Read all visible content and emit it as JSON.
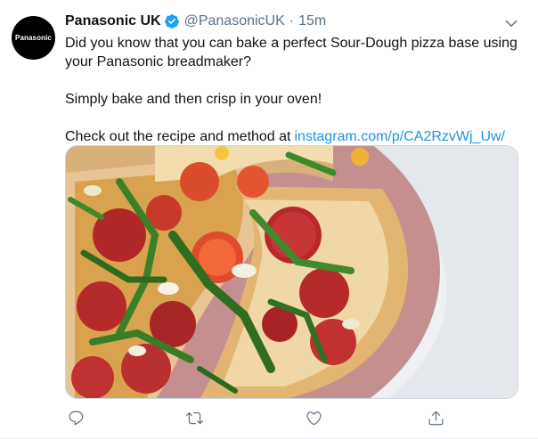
{
  "tweet": {
    "avatar_text": "Panasonic",
    "author_name": "Panasonic UK",
    "handle": "@PanasonicUK",
    "separator": "·",
    "time": "15m",
    "lines": [
      "Did you know that you can bake a perfect Sour-Dough pizza base using your Panasonic breadmaker?",
      "Simply bake and then crisp in your oven!",
      "Check out the recipe and method at"
    ],
    "link_text": "instagram.com/p/CA2RzvWj_Uw/",
    "media_description": "pizza-photo"
  },
  "icons": {
    "verified": "verified-badge-icon",
    "caret": "chevron-down-icon",
    "reply": "reply-icon",
    "retweet": "retweet-icon",
    "like": "heart-icon",
    "share": "share-icon"
  },
  "colors": {
    "link": "#1b95e0",
    "secondary": "#5b7083",
    "verified": "#1da1f2",
    "plate": "#c48f8f"
  }
}
